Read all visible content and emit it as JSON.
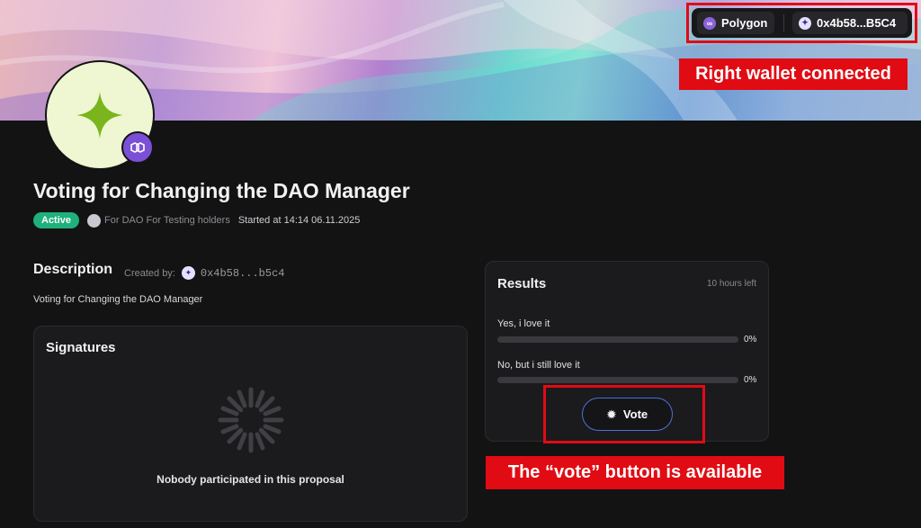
{
  "header": {
    "network_label": "Polygon",
    "wallet_label": "0x4b58...B5C4"
  },
  "annotations": {
    "wallet_note": "Right wallet connected",
    "vote_note": "The “vote” button is available",
    "highlight_color": "#e10b14"
  },
  "proposal": {
    "title": "Voting for Changing the DAO Manager",
    "status": "Active",
    "audience": "For DAO For Testing holders",
    "started": "Started at 14:14 06.11.2025",
    "avatar_icon": "four-point-star-icon",
    "network_icon": "polygon-icon"
  },
  "description": {
    "heading": "Description",
    "created_by_label": "Created by:",
    "creator_address": "0x4b58...b5c4",
    "text": "Voting for Changing the DAO Manager"
  },
  "signatures": {
    "heading": "Signatures",
    "empty_text": "Nobody participated in this proposal"
  },
  "results": {
    "heading": "Results",
    "time_left": "10 hours left",
    "options": [
      {
        "label": "Yes, i love it",
        "percent_text": "0%",
        "fraction": 0
      },
      {
        "label": "No, but i still love it",
        "percent_text": "0%",
        "fraction": 0
      }
    ],
    "vote_label": "Vote"
  },
  "colors": {
    "accent": "#7b4fd6",
    "active_green": "#1fb07c",
    "avatar_star": "#7ab51d"
  }
}
